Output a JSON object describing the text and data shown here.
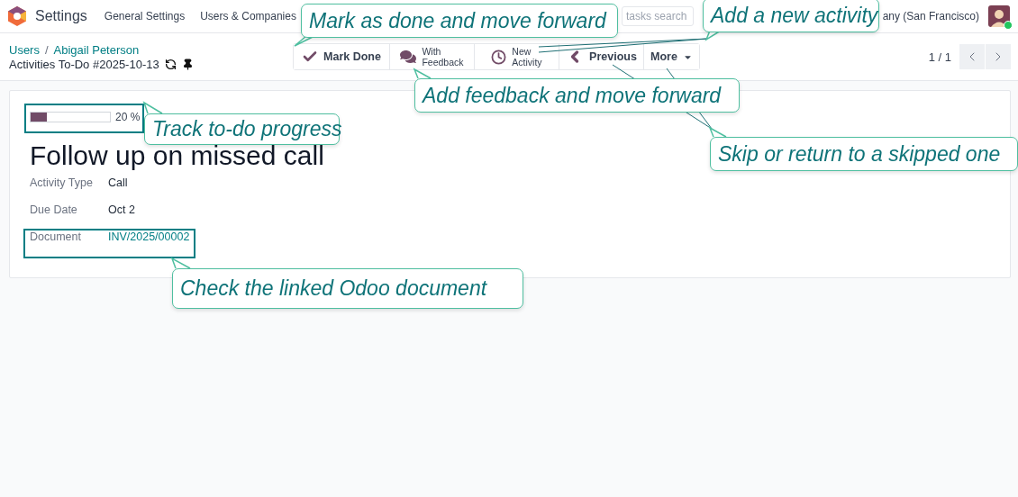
{
  "app": {
    "name": "Settings"
  },
  "menu": [
    {
      "label": "General Settings"
    },
    {
      "label": "Users & Companies"
    }
  ],
  "search": {
    "placeholder": "tasks search"
  },
  "company": "any (San Francisco)",
  "user": {
    "online": true
  },
  "breadcrumb": {
    "items": [
      "Users",
      "Abigail Peterson"
    ],
    "separator": "/"
  },
  "record_title": "Activities To-Do #2025-10-13",
  "actions": [
    {
      "kind": "check",
      "label": "Mark Done"
    },
    {
      "kind": "feedback",
      "label": "With Feedback"
    },
    {
      "kind": "clock",
      "label": "New Activity"
    },
    {
      "kind": "previous",
      "label": "Previous"
    },
    {
      "kind": "more",
      "label": "More"
    }
  ],
  "pager": "1 / 1",
  "progress": {
    "level": 0.2,
    "label": "20 %"
  },
  "title": "Follow up on missed call",
  "fields": [
    {
      "label": "Activity Type",
      "value": "Call",
      "kind": "text"
    },
    {
      "label": "Due Date",
      "value": "Oct 2",
      "kind": "text"
    },
    {
      "label": "Document",
      "value": "INV/2025/00002",
      "kind": "link"
    }
  ],
  "callouts": [
    {
      "text": "Mark as done and move forward"
    },
    {
      "text": "Add a new activity"
    },
    {
      "text": "Add feedback and move forward"
    },
    {
      "text": "Skip or return to a skipped one"
    },
    {
      "text": "Track to-do progress"
    },
    {
      "text": "Check the linked Odoo document"
    }
  ]
}
